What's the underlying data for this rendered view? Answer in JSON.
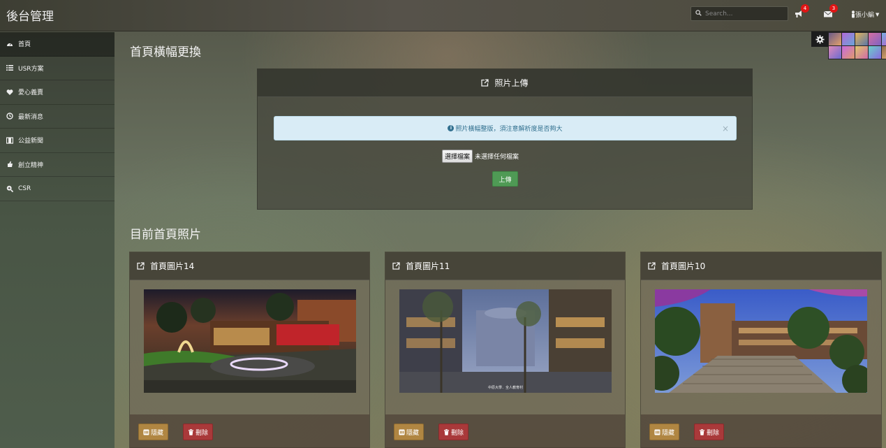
{
  "header": {
    "brand": "後台管理",
    "search_placeholder": "Search...",
    "announcements_badge": "4",
    "messages_badge": "3",
    "user_name": "張小編"
  },
  "sidebar": {
    "items": [
      {
        "label": "首頁",
        "icon": "dashboard-icon"
      },
      {
        "label": "USR方案",
        "icon": "list-icon"
      },
      {
        "label": "愛心義賣",
        "icon": "heart-icon"
      },
      {
        "label": "最新消息",
        "icon": "clock-icon"
      },
      {
        "label": "公益新聞",
        "icon": "film-icon"
      },
      {
        "label": "創立精神",
        "icon": "thumbs-up-icon"
      },
      {
        "label": "CSR",
        "icon": "search-plus-icon"
      }
    ]
  },
  "main": {
    "banner_section_title": "首頁橫幅更換",
    "upload_panel_title": "照片上傳",
    "alert_text": "照片橫幅整版，須注意解析度是否夠大",
    "file_button_label": "選擇檔案",
    "file_status": "未選擇任何檔案",
    "upload_button_label": "上傳",
    "current_section_title": "目前首頁照片"
  },
  "cards": [
    {
      "title": "首頁圖片14",
      "hide_label": "隱藏",
      "delete_label": "刪除"
    },
    {
      "title": "首頁圖片11",
      "hide_label": "隱藏",
      "delete_label": "刪除",
      "photo_caption": "中原大學．全人教育村"
    },
    {
      "title": "首頁圖片10",
      "hide_label": "隱藏",
      "delete_label": "刪除"
    }
  ],
  "colors": {
    "alert_bg": "#d9ecf6",
    "upload_green": "#4f9a55",
    "hide_gold": "#b08642",
    "delete_red": "#a9393a",
    "badge_red": "#e01515"
  }
}
